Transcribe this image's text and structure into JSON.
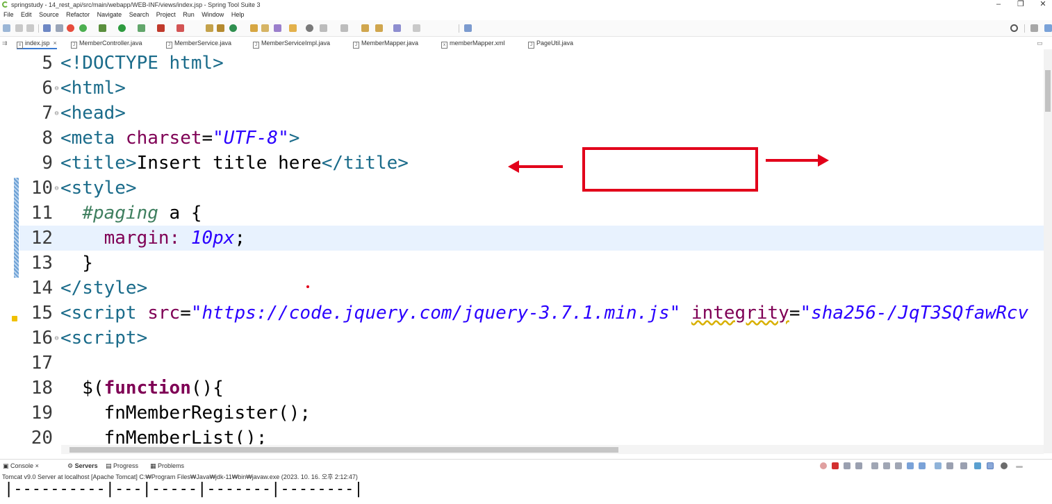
{
  "window": {
    "title": "springstudy - 14_rest_api/src/main/webapp/WEB-INF/views/index.jsp - Spring Tool Suite 3",
    "controls": [
      "–",
      "❐",
      "✕"
    ]
  },
  "menu": [
    "File",
    "Edit",
    "Source",
    "Refactor",
    "Navigate",
    "Search",
    "Project",
    "Run",
    "Window",
    "Help"
  ],
  "editor_tabs": [
    {
      "label": "index.jsp",
      "active": true
    },
    {
      "label": "MemberController.java"
    },
    {
      "label": "MemberService.java"
    },
    {
      "label": "MemberServiceImpl.java"
    },
    {
      "label": "MemberMapper.java"
    },
    {
      "label": "memberMapper.xml"
    },
    {
      "label": "PageUtil.java"
    }
  ],
  "code": {
    "lines": [
      {
        "n": "5"
      },
      {
        "n": "6"
      },
      {
        "n": "7"
      },
      {
        "n": "8"
      },
      {
        "n": "9"
      },
      {
        "n": "10"
      },
      {
        "n": "11"
      },
      {
        "n": "12"
      },
      {
        "n": "13"
      },
      {
        "n": "14"
      },
      {
        "n": "15"
      },
      {
        "n": "16"
      },
      {
        "n": "17"
      },
      {
        "n": "18"
      },
      {
        "n": "19"
      },
      {
        "n": "20"
      }
    ],
    "t": {
      "l5": "<!DOCTYPE html>",
      "l6": "<html>",
      "l7": "<head>",
      "l8a": "<meta ",
      "l8b": "charset",
      "l8c": "=",
      "l8d": "\"UTF-8\"",
      "l8e": ">",
      "l9a": "<title>",
      "l9b": "Insert title here",
      "l9c": "</title>",
      "l10": "<style>",
      "l11a": "  ",
      "l11b": "#paging",
      "l11c": " a {",
      "l12a": "    margin: ",
      "l12b": "10px",
      "l12c": ";",
      "l13": "  }",
      "l14": "</style>",
      "l15a": "<script ",
      "l15b": "src",
      "l15c": "=",
      "l15d": "\"https://code.jquery.com/jquery-3.7.1.min.js\"",
      "l15e": " ",
      "l15f": "integrity",
      "l15g": "=",
      "l15h": "\"sha256-/JqT3SQfawRcv",
      "l16": "<script>",
      "l18a": "  $(",
      "l18b": "function",
      "l18c": "(){",
      "l19": "    fnMemberRegister();",
      "l20": "    fnMemberList();"
    }
  },
  "console": {
    "tabs": [
      {
        "label": "Console"
      },
      {
        "label": "Servers"
      },
      {
        "label": "Progress"
      },
      {
        "label": "Problems"
      }
    ],
    "description": "Tomcat v9.0 Server at localhost [Apache Tomcat] C:₩Program Files₩Java₩jdk-11₩bin₩javaw.exe  (2023. 10. 16. 오후 2:12:47)",
    "output": "|----------|---|-----|-------|--------|"
  },
  "colors": {
    "annotation": "#e2001a",
    "tag": "#1a6b8a",
    "string": "#2a00ff",
    "keyword": "#7f0055"
  }
}
